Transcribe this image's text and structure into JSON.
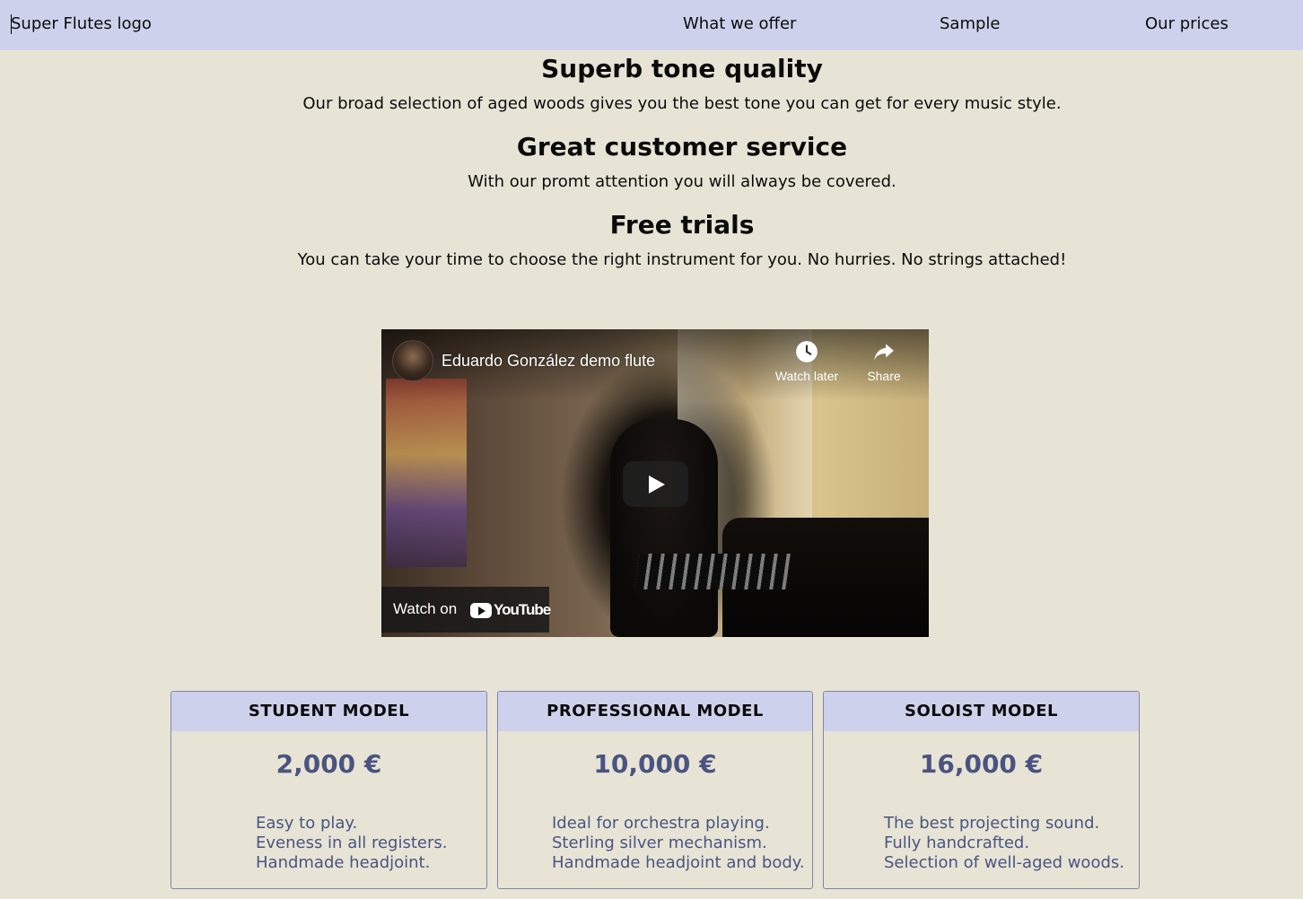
{
  "nav": {
    "logo": "Super Flutes logo",
    "links": [
      "What we offer",
      "Sample",
      "Our prices"
    ]
  },
  "features": [
    {
      "heading": "Superb tone quality",
      "text": "Our broad selection of aged woods gives you the best tone you can get for every music style."
    },
    {
      "heading": "Great customer service",
      "text": "With our promt attention you will always be covered."
    },
    {
      "heading": "Free trials",
      "text": "You can take your time to choose the right instrument for you. No hurries. No strings attached!"
    }
  ],
  "video": {
    "title": "Eduardo González demo flute",
    "watch_later": "Watch later",
    "share": "Share",
    "watch_on": "Watch on",
    "brand": "YouTube"
  },
  "pricing": [
    {
      "model": "STUDENT MODEL",
      "price": "2,000 €",
      "features": [
        "Easy to play.",
        "Eveness in all registers.",
        "Handmade headjoint."
      ]
    },
    {
      "model": "PROFESSIONAL MODEL",
      "price": "10,000 €",
      "features": [
        "Ideal for orchestra playing.",
        "Sterling silver mechanism.",
        "Handmade headjoint and body."
      ]
    },
    {
      "model": "SOLOIST MODEL",
      "price": "16,000 €",
      "features": [
        "The best projecting sound.",
        "Fully handcrafted.",
        "Selection of well-aged woods."
      ]
    }
  ],
  "colors": {
    "page_background": "#e7e4d6",
    "nav_background": "#cdd1eb",
    "price_text": "#4a5480"
  }
}
